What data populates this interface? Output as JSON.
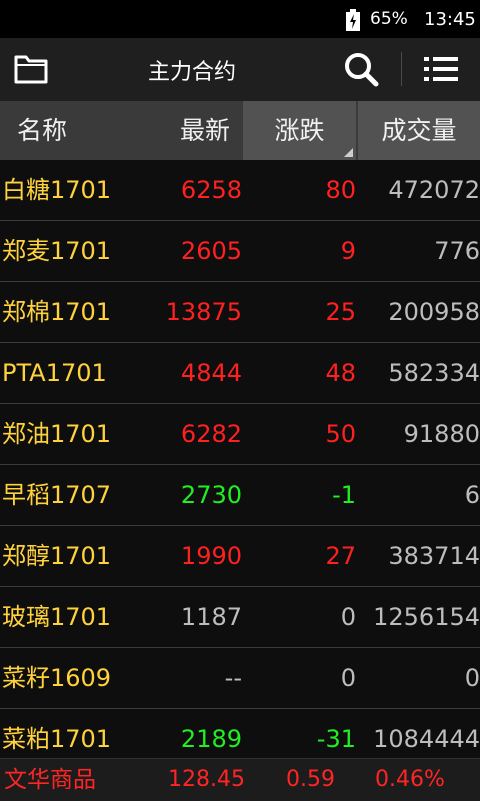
{
  "status": {
    "battery": "65%",
    "time": "13:45"
  },
  "title": "主力合约",
  "columns": {
    "name": "名称",
    "latest": "最新",
    "change": "涨跌",
    "volume": "成交量"
  },
  "rows": [
    {
      "name": "白糖1701",
      "latest": "6258",
      "change": "80",
      "volume": "472072",
      "dir": "up"
    },
    {
      "name": "郑麦1701",
      "latest": "2605",
      "change": "9",
      "volume": "776",
      "dir": "up"
    },
    {
      "name": "郑棉1701",
      "latest": "13875",
      "change": "25",
      "volume": "200958",
      "dir": "up"
    },
    {
      "name": "PTA1701",
      "latest": "4844",
      "change": "48",
      "volume": "582334",
      "dir": "up"
    },
    {
      "name": "郑油1701",
      "latest": "6282",
      "change": "50",
      "volume": "91880",
      "dir": "up"
    },
    {
      "name": "早稻1707",
      "latest": "2730",
      "change": "-1",
      "volume": "6",
      "dir": "down"
    },
    {
      "name": "郑醇1701",
      "latest": "1990",
      "change": "27",
      "volume": "383714",
      "dir": "up"
    },
    {
      "name": "玻璃1701",
      "latest": "1187",
      "change": "0",
      "volume": "1256154",
      "dir": "flat"
    },
    {
      "name": "菜籽1609",
      "latest": "--",
      "change": "0",
      "volume": "0",
      "dir": "flat"
    },
    {
      "name": "菜粕1701",
      "latest": "2189",
      "change": "-31",
      "volume": "1084444",
      "dir": "down"
    }
  ],
  "footer": {
    "name": "文华商品",
    "price": "128.45",
    "change": "0.59",
    "percent": "0.46%"
  },
  "colors": {
    "up": "#ff2020",
    "down": "#22ee22",
    "flat": "#bdbdbd",
    "name": "#ffd23c"
  },
  "icons": {
    "battery": "battery-charging-icon",
    "folder": "folder-icon",
    "search": "search-icon",
    "menu": "list-menu-icon",
    "sort": "sort-triangle-icon"
  }
}
